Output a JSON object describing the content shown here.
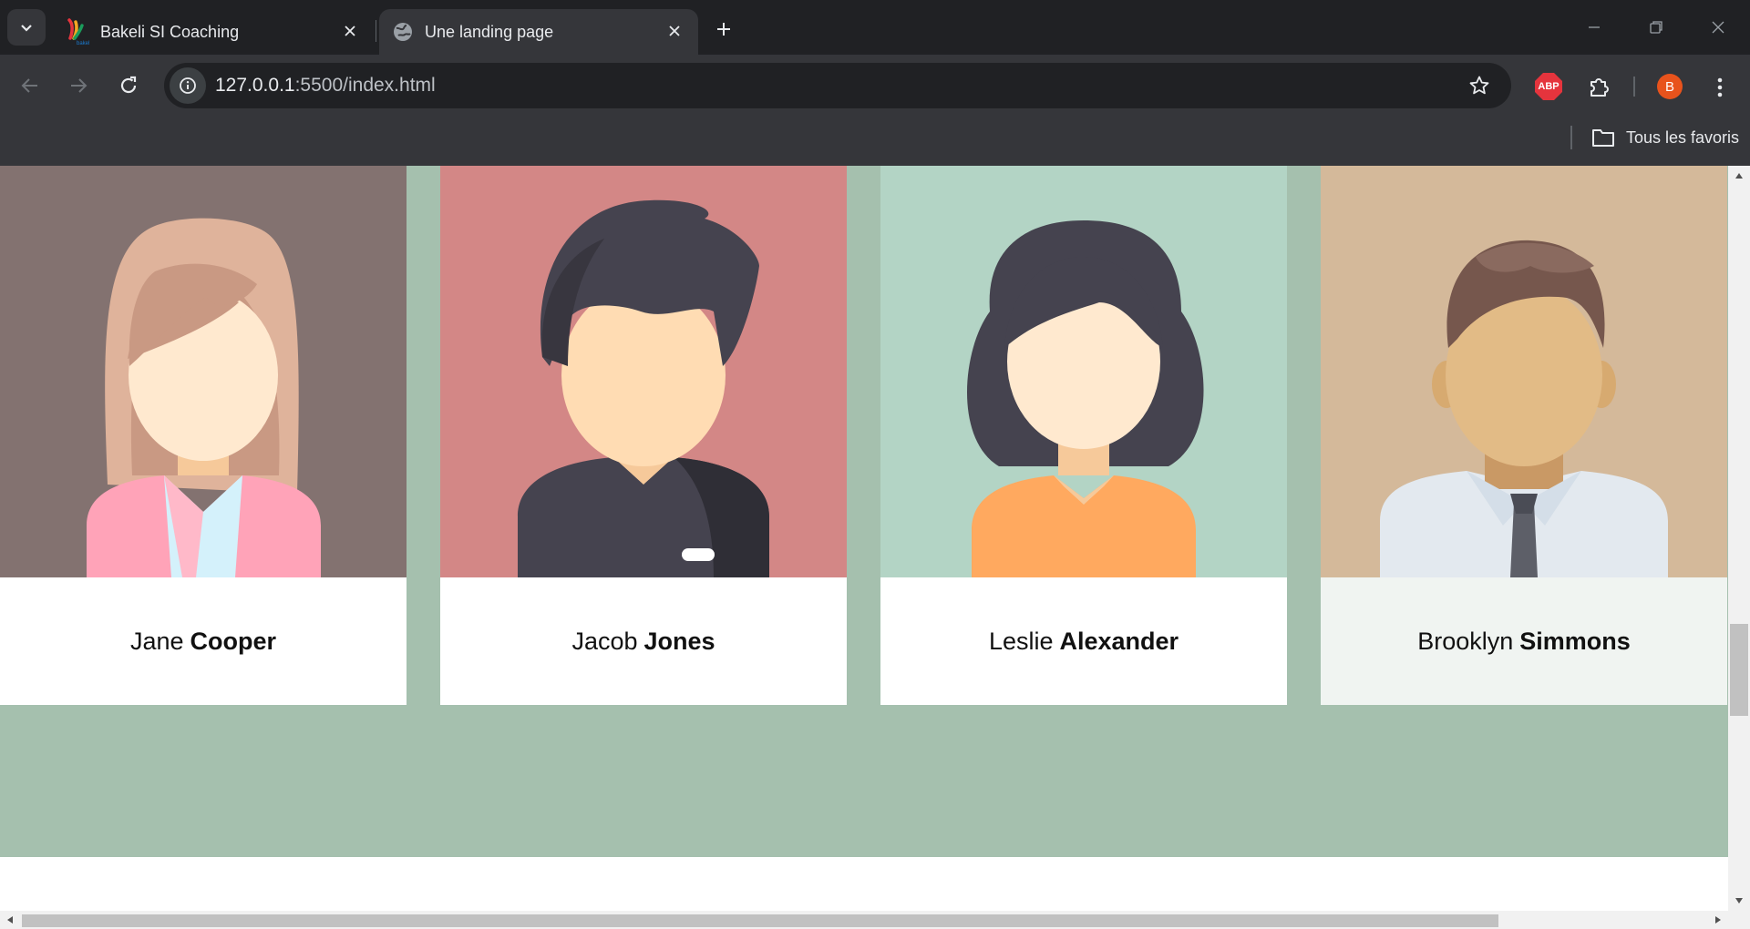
{
  "browser": {
    "tabs": [
      {
        "title": "Bakeli SI Coaching",
        "icon": "bakeli-logo-icon",
        "active": false
      },
      {
        "title": "Une landing page",
        "icon": "globe-icon",
        "active": true
      }
    ],
    "url": {
      "host": "127.0.0.1",
      "rest": ":5500/index.html"
    },
    "profile_initial": "B",
    "adblock_label": "ABP",
    "bookmarks": {
      "all_label": "Tous les favoris"
    }
  },
  "team": {
    "background_color": "#a5c0ae",
    "members": [
      {
        "first": "Jane",
        "last": "Cooper",
        "photo_bg": "#837270",
        "caption_bg": "#ffffff",
        "avatar": "woman-long-hair-avatar"
      },
      {
        "first": "Jacob",
        "last": "Jones",
        "photo_bg": "#d38786",
        "caption_bg": "#ffffff",
        "avatar": "man-dark-hair-avatar"
      },
      {
        "first": "Leslie",
        "last": "Alexander",
        "photo_bg": "#b3d4c5",
        "caption_bg": "#ffffff",
        "avatar": "woman-dark-hair-avatar"
      },
      {
        "first": "Brooklyn",
        "last": "Simmons",
        "photo_bg": "#d4b99a",
        "caption_bg": "#f0f4f1",
        "avatar": "man-tie-avatar"
      }
    ]
  }
}
